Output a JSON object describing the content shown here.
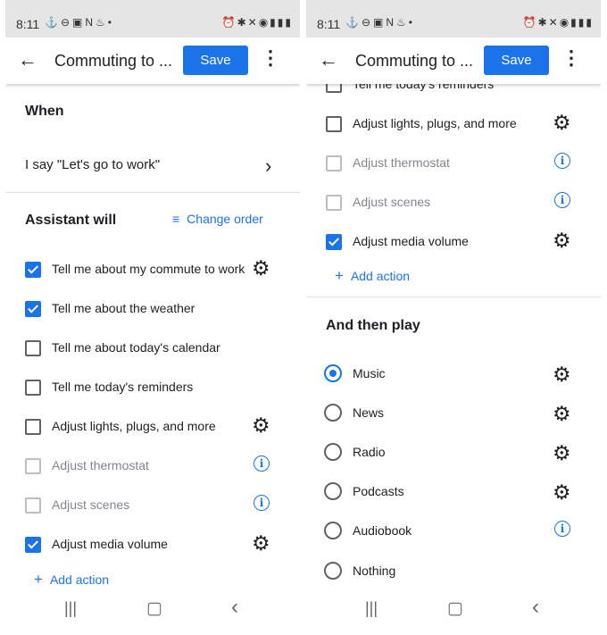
{
  "status_bar": {
    "time": "8:11"
  },
  "app_bar": {
    "title": "Commuting to ...",
    "save_label": "Save"
  },
  "left": {
    "when_title": "When",
    "trigger_phrase": "I say \"Let's go to work\"",
    "assistant_title": "Assistant will",
    "change_order_label": "Change order",
    "actions": [
      {
        "label": "Tell me about my commute to work",
        "checked": true,
        "disabled": false,
        "icon": "gear-icon"
      },
      {
        "label": "Tell me about the weather",
        "checked": true,
        "disabled": false,
        "icon": ""
      },
      {
        "label": "Tell me about today's calendar",
        "checked": false,
        "disabled": false,
        "icon": ""
      },
      {
        "label": "Tell me today's reminders",
        "checked": false,
        "disabled": false,
        "icon": ""
      },
      {
        "label": "Adjust lights, plugs, and more",
        "checked": false,
        "disabled": false,
        "icon": "gear-icon"
      },
      {
        "label": "Adjust thermostat",
        "checked": false,
        "disabled": true,
        "icon": "info-icon"
      },
      {
        "label": "Adjust scenes",
        "checked": false,
        "disabled": true,
        "icon": "info-icon"
      },
      {
        "label": "Adjust media volume",
        "checked": true,
        "disabled": false,
        "icon": "gear-icon"
      }
    ],
    "add_action_label": "Add action"
  },
  "right": {
    "partial_item_label": "Tell me today's reminders",
    "actions": [
      {
        "label": "Adjust lights, plugs, and more",
        "checked": false,
        "disabled": false,
        "icon": "gear-icon"
      },
      {
        "label": "Adjust thermostat",
        "checked": false,
        "disabled": true,
        "icon": "info-icon"
      },
      {
        "label": "Adjust scenes",
        "checked": false,
        "disabled": true,
        "icon": "info-icon"
      },
      {
        "label": "Adjust media volume",
        "checked": true,
        "disabled": false,
        "icon": "gear-icon"
      }
    ],
    "add_action_label": "Add action",
    "then_play_title": "And then play",
    "media_options": [
      {
        "label": "Music",
        "selected": true,
        "icon": "gear-icon"
      },
      {
        "label": "News",
        "selected": false,
        "icon": "gear-icon"
      },
      {
        "label": "Radio",
        "selected": false,
        "icon": "gear-icon"
      },
      {
        "label": "Podcasts",
        "selected": false,
        "icon": "gear-icon"
      },
      {
        "label": "Audiobook",
        "selected": false,
        "icon": "info-icon"
      },
      {
        "label": "Nothing",
        "selected": false,
        "icon": ""
      }
    ]
  },
  "colors": {
    "accent": "#1a73e8",
    "status_bar": "#e5e5e5"
  }
}
